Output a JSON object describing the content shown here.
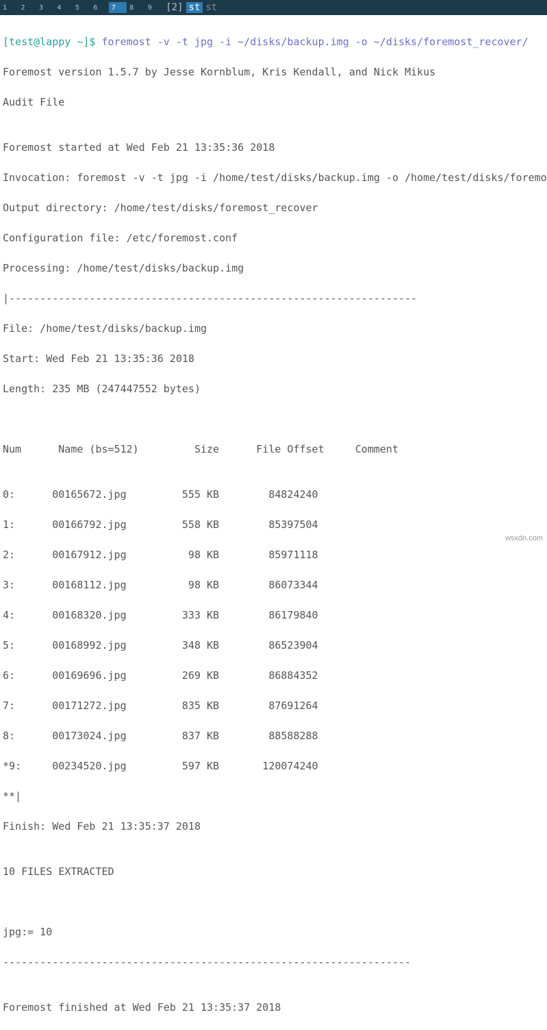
{
  "tabs": [
    {
      "num": "1",
      "label": ""
    },
    {
      "num": "2",
      "label": ""
    },
    {
      "num": "3",
      "label": ""
    },
    {
      "num": "4",
      "label": ""
    },
    {
      "num": "5",
      "label": ""
    },
    {
      "num": "6",
      "label": ""
    },
    {
      "num": "7",
      "label": "",
      "active": true
    },
    {
      "num": "8",
      "label": ""
    },
    {
      "num": "9",
      "label": ""
    },
    {
      "num": "",
      "label": "[2]"
    },
    {
      "num": "",
      "label": "st",
      "active": true
    },
    {
      "num": "",
      "label": "st",
      "dim": true
    }
  ],
  "prompt": {
    "user": "[test@lappy ~]$ ",
    "command": "foremost -v -t jpg -i ~/disks/backup.img -o ~/disks/foremost_recover/"
  },
  "lines": {
    "l0": "Foremost version 1.5.7 by Jesse Kornblum, Kris Kendall, and Nick Mikus",
    "l1": "Audit File",
    "l2": "",
    "l3": "Foremost started at Wed Feb 21 13:35:36 2018",
    "l4": "Invocation: foremost -v -t jpg -i /home/test/disks/backup.img -o /home/test/disks/foremos",
    "l5": "Output directory: /home/test/disks/foremost_recover",
    "l6": "Configuration file: /etc/foremost.conf",
    "l7": "Processing: /home/test/disks/backup.img",
    "l8": "|------------------------------------------------------------------",
    "l9": "File: /home/test/disks/backup.img",
    "l10": "Start: Wed Feb 21 13:35:36 2018",
    "l11": "Length: 235 MB (247447552 bytes)",
    "l12": " ",
    "l13": "Num\t Name (bs=512)\t       Size\t File Offset\t Comment ",
    "l14": "",
    "l15": "0:\t00165672.jpg \t     555 KB \t   84824240    \t ",
    "l16": "1:\t00166792.jpg \t     558 KB \t   85397504    \t ",
    "l17": "2:\t00167912.jpg \t      98 KB \t   85971118    \t ",
    "l18": "3:\t00168112.jpg \t      98 KB \t   86073344    \t ",
    "l19": "4:\t00168320.jpg \t     333 KB \t   86179840    \t ",
    "l20": "5:\t00168992.jpg \t     348 KB \t   86523904    \t ",
    "l21": "6:\t00169696.jpg \t     269 KB \t   86884352    \t ",
    "l22": "7:\t00171272.jpg \t     835 KB \t   87691264    \t ",
    "l23": "8:\t00173024.jpg \t     837 KB \t   88588288    \t ",
    "l24": "*9:\t00234520.jpg \t     597 KB \t  120074240    \t ",
    "l25": "**|",
    "l26": "Finish: Wed Feb 21 13:35:37 2018",
    "l27": "",
    "l28": "10 FILES EXTRACTED",
    "l29": "\t",
    "l30": "jpg:= 10",
    "l31": "------------------------------------------------------------------",
    "l32": "",
    "l33": "Foremost finished at Wed Feb 21 13:35:37 2018"
  },
  "watermark": "wsxdn.com"
}
